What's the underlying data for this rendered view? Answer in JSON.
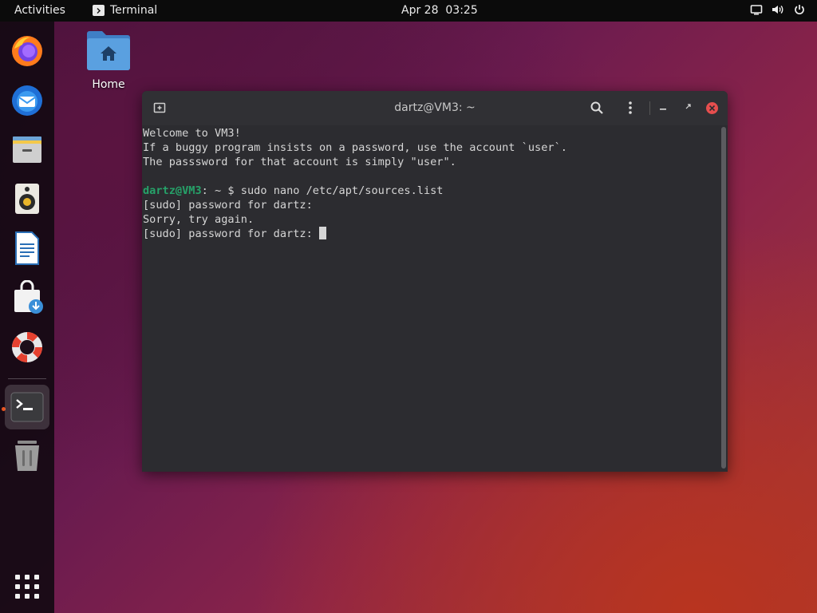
{
  "topbar": {
    "activities": "Activities",
    "app_name": "Terminal",
    "date": "Apr 28",
    "time": "03:25"
  },
  "desktop": {
    "home_label": "Home"
  },
  "dock": {
    "items": [
      "firefox",
      "thunderbird",
      "files",
      "rhythmbox",
      "libreoffice-writer",
      "software-center",
      "help",
      "terminal",
      "trash",
      "show-applications"
    ]
  },
  "terminal": {
    "title": "dartz@VM3: ~",
    "lines": {
      "l1": "Welcome to VM3!",
      "l2": "If a buggy program insists on a password, use the account `user`.",
      "l3": "The passsword for that account is simply \"user\".",
      "prompt_user": "dartz@VM3",
      "prompt_rest": ": ~",
      "prompt_cmd": " $ sudo nano /etc/apt/sources.list",
      "l5": "[sudo] password for dartz:",
      "l6": "Sorry, try again.",
      "l7": "[sudo] password for dartz: "
    }
  },
  "colors": {
    "prompt": "#26a269",
    "accent": "#e95420"
  }
}
